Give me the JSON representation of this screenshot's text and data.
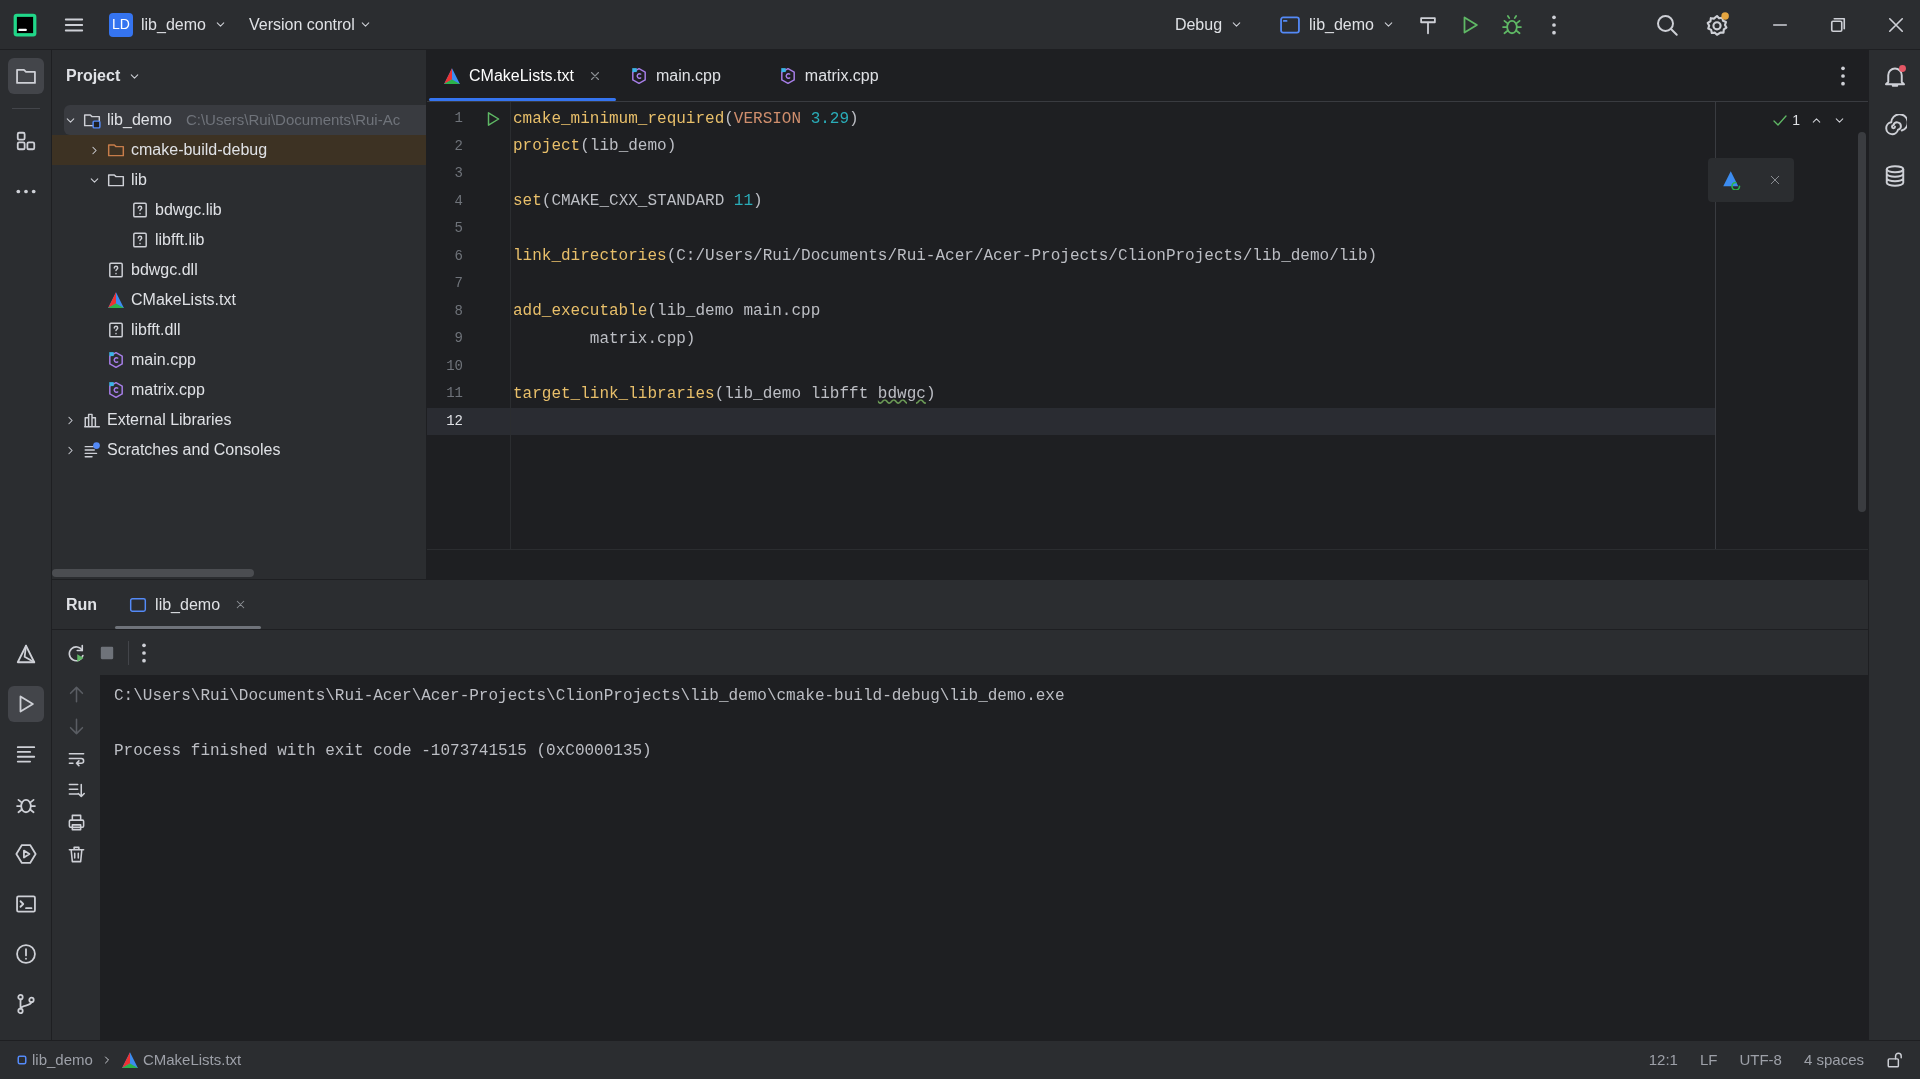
{
  "title_bar": {
    "project_badge": "LD",
    "project": "lib_demo",
    "vcs": "Version control",
    "config": "Debug",
    "run_target": "lib_demo"
  },
  "left_tools": [
    {
      "kind": "folder",
      "selected": true
    },
    {
      "kind": "structure",
      "selected": false
    },
    {
      "kind": "more",
      "selected": false
    }
  ],
  "left_tools_bottom": [
    {
      "kind": "cmake",
      "selected": false
    },
    {
      "kind": "run",
      "selected": true
    },
    {
      "kind": "log",
      "selected": false
    },
    {
      "kind": "debug",
      "selected": false
    },
    {
      "kind": "services",
      "selected": false
    },
    {
      "kind": "terminal",
      "selected": false
    },
    {
      "kind": "problems",
      "selected": false
    },
    {
      "kind": "git",
      "selected": false
    }
  ],
  "project_panel": {
    "title": "Project",
    "tree": [
      {
        "label": "lib_demo",
        "path": "C:\\Users\\Rui\\Documents\\Rui-Ac",
        "kind": "module",
        "expanded": true,
        "selected": true,
        "children": [
          {
            "label": "cmake-build-debug",
            "kind": "excluded",
            "expanded": false,
            "selected": false
          },
          {
            "label": "lib",
            "kind": "folder",
            "expanded": true,
            "selected": false,
            "children": [
              {
                "label": "bdwgc.lib",
                "kind": "unknown",
                "selected": false
              },
              {
                "label": "libfft.lib",
                "kind": "unknown",
                "selected": false
              }
            ]
          },
          {
            "label": "bdwgc.dll",
            "kind": "unknown",
            "selected": false
          },
          {
            "label": "CMakeLists.txt",
            "kind": "cmake",
            "selected": false
          },
          {
            "label": "libfft.dll",
            "kind": "unknown",
            "selected": false
          },
          {
            "label": "main.cpp",
            "kind": "cpp",
            "selected": false
          },
          {
            "label": "matrix.cpp",
            "kind": "cpp",
            "selected": false
          }
        ]
      },
      {
        "label": "External Libraries",
        "kind": "library",
        "expanded": false,
        "selected": false
      },
      {
        "label": "Scratches and Consoles",
        "kind": "scratch",
        "expanded": false,
        "selected": false
      }
    ]
  },
  "editor_tabs": [
    {
      "label": "CMakeLists.txt",
      "kind": "cmake",
      "selected": true
    },
    {
      "label": "main.cpp",
      "kind": "cpp",
      "selected": false
    },
    {
      "label": "matrix.cpp",
      "kind": "cpp",
      "selected": false
    }
  ],
  "inspection": {
    "count": "1"
  },
  "code_lines": [
    {
      "number": "1",
      "current": false,
      "tokens": [
        {
          "kind": "fn",
          "text": "cmake_minimum_required"
        },
        {
          "kind": "text",
          "text": "("
        },
        {
          "kind": "kw",
          "text": "VERSION"
        },
        {
          "kind": "num",
          "text": "3.29",
          "space_before": true
        },
        {
          "kind": "text",
          "text": ")"
        }
      ]
    },
    {
      "number": "2",
      "current": false,
      "tokens": [
        {
          "kind": "fn",
          "text": "project"
        },
        {
          "kind": "text",
          "text": "(lib_demo)"
        }
      ]
    },
    {
      "number": "3",
      "current": false
    },
    {
      "number": "4",
      "current": false,
      "tokens": [
        {
          "kind": "fn",
          "text": "set"
        },
        {
          "kind": "text",
          "text": "(CMAKE_CXX_STANDARD"
        },
        {
          "kind": "num",
          "text": "11",
          "space_before": true
        },
        {
          "kind": "text",
          "text": ")"
        }
      ]
    },
    {
      "number": "5",
      "current": false
    },
    {
      "number": "6",
      "current": false,
      "tokens": [
        {
          "kind": "fn",
          "text": "link_directories"
        },
        {
          "kind": "text",
          "text": "(C:/Users/Rui/Documents/Rui-Acer/Acer-Projects/ClionProjects/lib_demo/lib)"
        }
      ]
    },
    {
      "number": "7",
      "current": false
    },
    {
      "number": "8",
      "current": false,
      "tokens": [
        {
          "kind": "fn",
          "text": "add_executable"
        },
        {
          "kind": "text",
          "text": "(lib_demo main.cpp"
        }
      ]
    },
    {
      "number": "9",
      "current": false,
      "tokens": [
        {
          "kind": "text",
          "text": "        matrix.cpp)"
        }
      ]
    },
    {
      "number": "10",
      "current": false
    },
    {
      "number": "11",
      "current": false,
      "tokens": [
        {
          "kind": "fn",
          "text": "target_link_libraries"
        },
        {
          "kind": "text",
          "text": "(lib_demo libfft"
        },
        {
          "kind": "warn",
          "text": "bdwgc",
          "space_before": true
        },
        {
          "kind": "text",
          "text": ")"
        }
      ]
    },
    {
      "number": "12",
      "current": true
    }
  ],
  "run_panel": {
    "title": "Run",
    "tabs": [
      {
        "label": "lib_demo",
        "selected": true
      }
    ],
    "output": [
      "C:\\Users\\Rui\\Documents\\Rui-Acer\\Acer-Projects\\ClionProjects\\lib_demo\\cmake-build-debug\\lib_demo.exe",
      "Process finished with exit code -1073741515 (0xC0000135)"
    ]
  },
  "status_bar": {
    "breadcrumbs": [
      {
        "label": "lib_demo",
        "kind": "module"
      },
      {
        "label": "CMakeLists.txt",
        "kind": "cmake"
      }
    ],
    "position": "12:1",
    "line_sep": "LF",
    "encoding": "UTF-8",
    "indent": "4 spaces"
  }
}
